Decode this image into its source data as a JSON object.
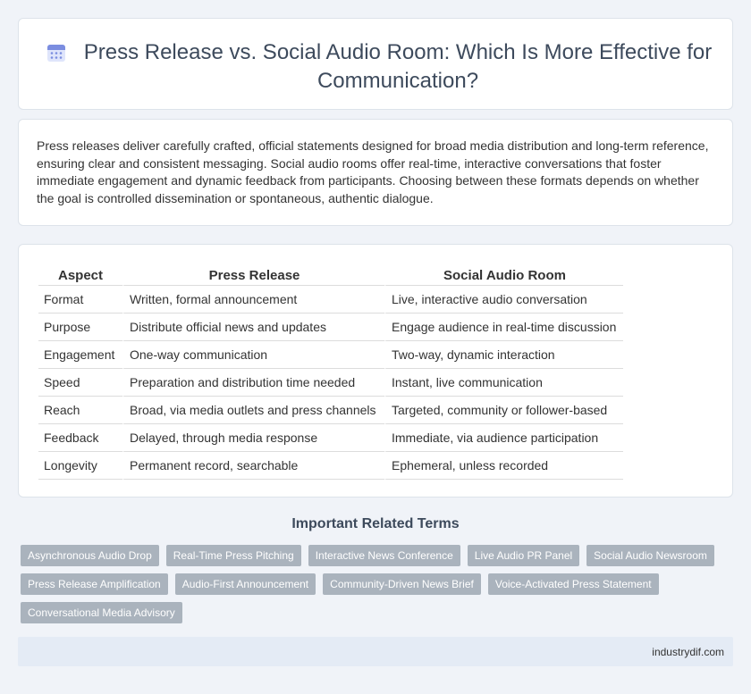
{
  "header": {
    "title": "Press Release vs. Social Audio Room: Which Is More Effective for Communication?",
    "icon": "calendar-icon"
  },
  "intro": {
    "text": "Press releases deliver carefully crafted, official statements designed for broad media distribution and long-term reference, ensuring clear and consistent messaging. Social audio rooms offer real-time, interactive conversations that foster immediate engagement and dynamic feedback from participants. Choosing between these formats depends on whether the goal is controlled dissemination or spontaneous, authentic dialogue."
  },
  "table": {
    "headers": [
      "Aspect",
      "Press Release",
      "Social Audio Room"
    ],
    "rows": [
      [
        "Format",
        "Written, formal announcement",
        "Live, interactive audio conversation"
      ],
      [
        "Purpose",
        "Distribute official news and updates",
        "Engage audience in real-time discussion"
      ],
      [
        "Engagement",
        "One-way communication",
        "Two-way, dynamic interaction"
      ],
      [
        "Speed",
        "Preparation and distribution time needed",
        "Instant, live communication"
      ],
      [
        "Reach",
        "Broad, via media outlets and press channels",
        "Targeted, community or follower-based"
      ],
      [
        "Feedback",
        "Delayed, through media response",
        "Immediate, via audience participation"
      ],
      [
        "Longevity",
        "Permanent record, searchable",
        "Ephemeral, unless recorded"
      ]
    ]
  },
  "related": {
    "title": "Important Related Terms",
    "tags": [
      "Asynchronous Audio Drop",
      "Real-Time Press Pitching",
      "Interactive News Conference",
      "Live Audio PR Panel",
      "Social Audio Newsroom",
      "Press Release Amplification",
      "Audio-First Announcement",
      "Community-Driven News Brief",
      "Voice-Activated Press Statement",
      "Conversational Media Advisory"
    ]
  },
  "footer": {
    "site": "industrydif.com"
  },
  "colors": {
    "background": "#f0f3f8",
    "tag": "#aab3bd",
    "footer": "#e4ebf5",
    "icon": "#7b8de0"
  }
}
